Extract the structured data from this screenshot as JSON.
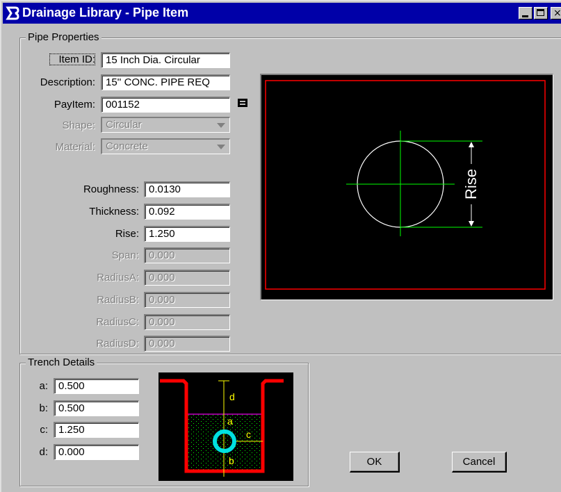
{
  "window": {
    "title": "Drainage Library - Pipe Item",
    "app_icon": "bentley-b-icon",
    "controls": {
      "minimize": "minimize-icon",
      "maximize": "maximize-icon",
      "close": "×"
    }
  },
  "pipe_properties": {
    "legend": "Pipe Properties",
    "item_id": {
      "label": "Item ID:",
      "value": "15 Inch Dia. Circular"
    },
    "description": {
      "label": "Description:",
      "value": "15'' CONC. PIPE REQ"
    },
    "payitem": {
      "label": "PayItem:",
      "value": "001152",
      "icon": "calculator-icon"
    },
    "shape": {
      "label": "Shape:",
      "value": "Circular"
    },
    "material": {
      "label": "Material:",
      "value": "Concrete"
    },
    "roughness": {
      "label": "Roughness:",
      "value": "0.0130"
    },
    "thickness": {
      "label": "Thickness:",
      "value": "0.092"
    },
    "rise": {
      "label": "Rise:",
      "value": "1.250"
    },
    "span": {
      "label": "Span:",
      "value": "0.000"
    },
    "radius_a": {
      "label": "RadiusA:",
      "value": "0.000"
    },
    "radius_b": {
      "label": "RadiusB:",
      "value": "0.000"
    },
    "radius_c": {
      "label": "RadiusC:",
      "value": "0.000"
    },
    "radius_d": {
      "label": "RadiusD:",
      "value": "0.000"
    }
  },
  "preview": {
    "dimension_label": "Rise",
    "colors": {
      "frame": "#ff0000",
      "circle": "#ffffff",
      "axes": "#00ff00"
    }
  },
  "trench_details": {
    "legend": "Trench Details",
    "a": {
      "label": "a:",
      "value": "0.500"
    },
    "b": {
      "label": "b:",
      "value": "0.500"
    },
    "c": {
      "label": "c:",
      "value": "1.250"
    },
    "d": {
      "label": "d:",
      "value": "0.000"
    },
    "diagram_labels": {
      "a": "a",
      "b": "b",
      "c": "c",
      "d": "d"
    },
    "colors": {
      "trench": "#ff0000",
      "pipe": "#00e0e0",
      "dims": "#ffff00",
      "bedding": "#00ff00",
      "fill_line": "#c000c0"
    }
  },
  "buttons": {
    "ok": "OK",
    "cancel": "Cancel"
  }
}
